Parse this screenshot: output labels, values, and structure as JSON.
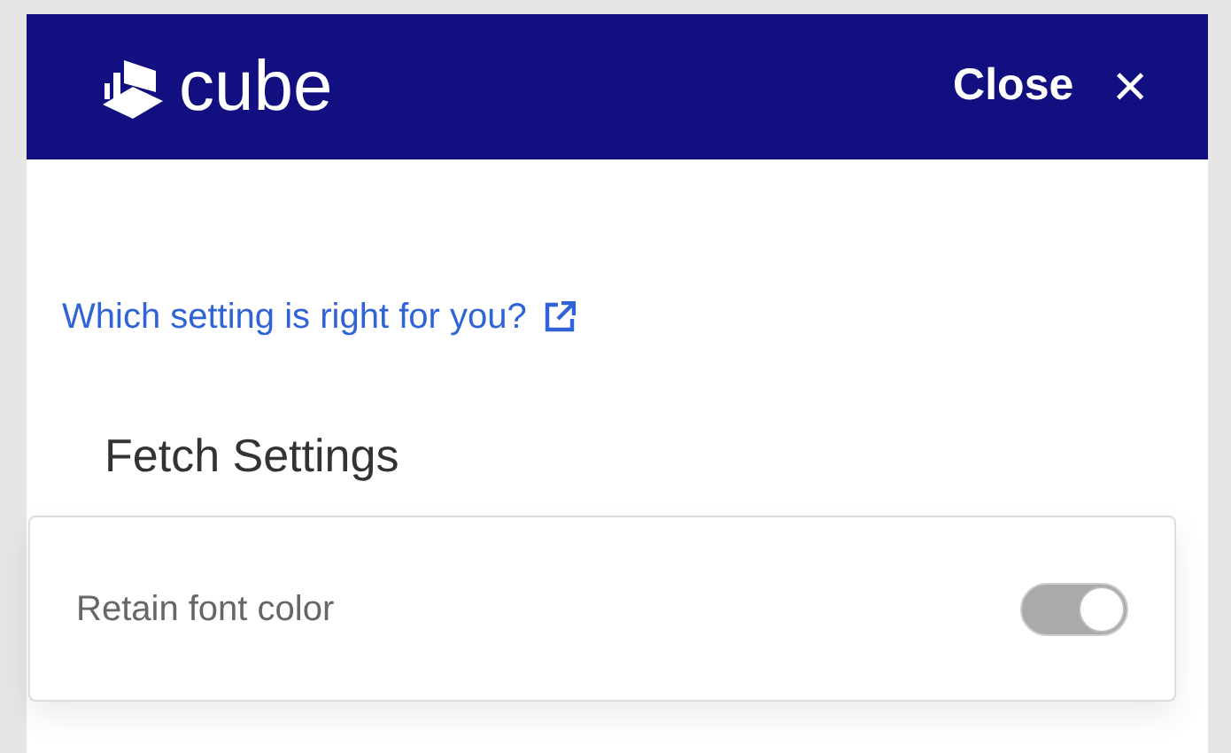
{
  "header": {
    "logo_text": "cube",
    "close_label": "Close",
    "close_glyph": "×"
  },
  "help_link": {
    "label": "Which setting is right for you?"
  },
  "section": {
    "title": "Fetch Settings"
  },
  "settings": [
    {
      "label": "Retain font color",
      "on": true,
      "disabled": true
    }
  ]
}
